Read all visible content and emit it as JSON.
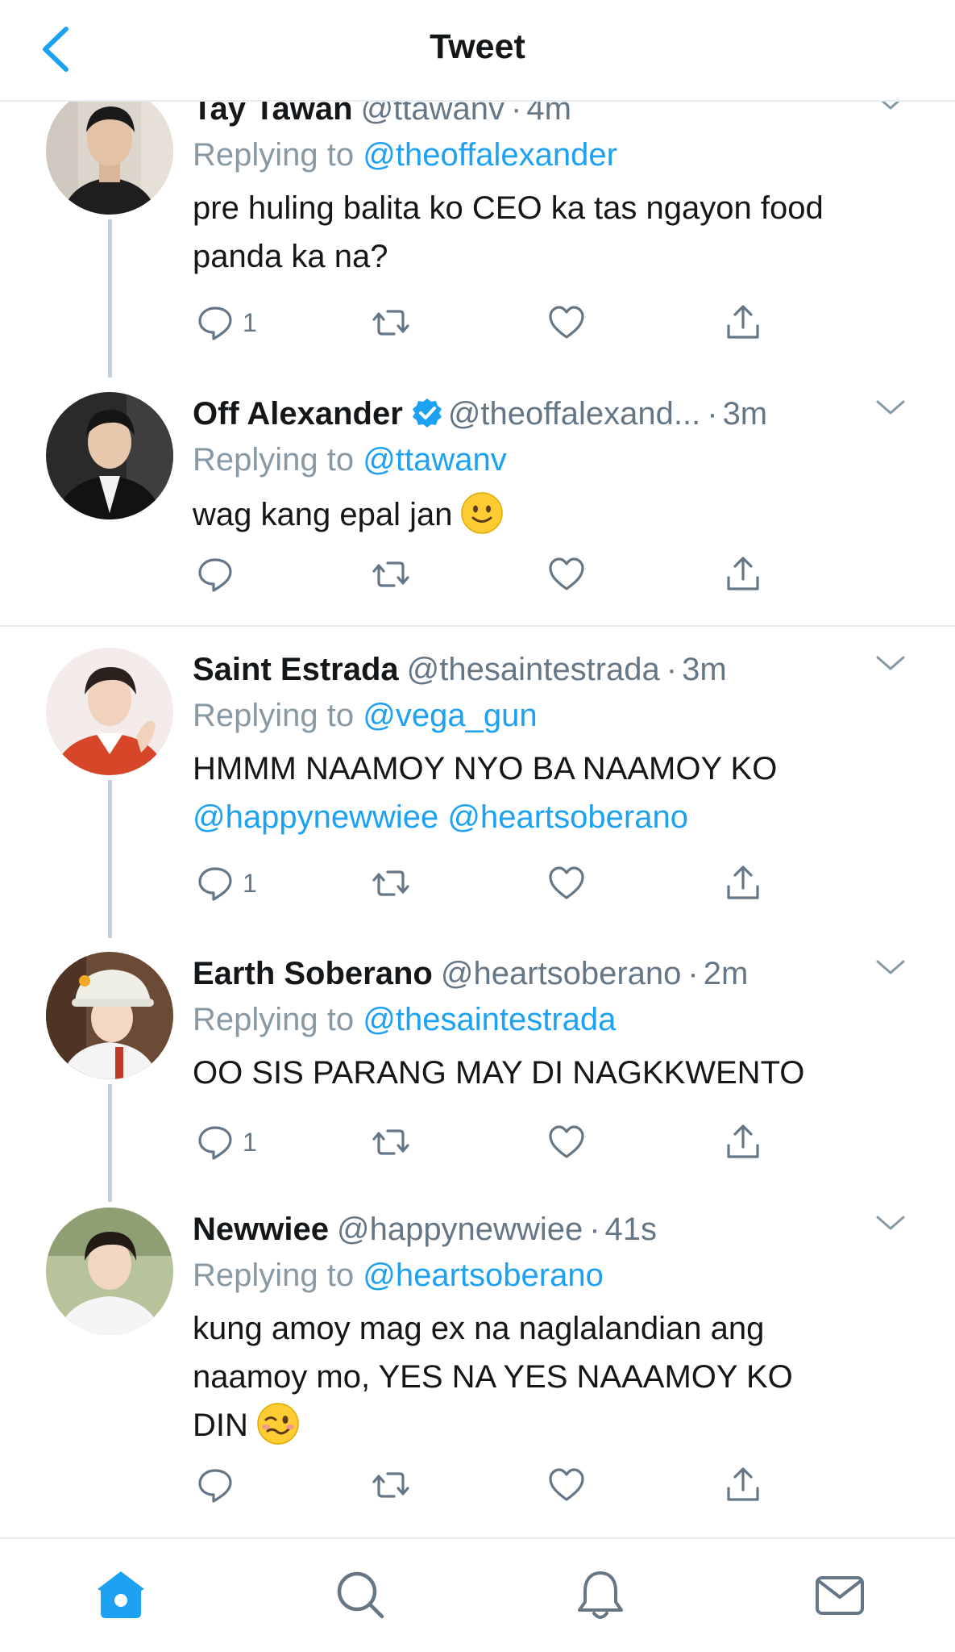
{
  "header": {
    "title": "Tweet"
  },
  "tweets": [
    {
      "name": "Tay Tawan",
      "handle": "@ttawanv",
      "time": "4m",
      "replying_prefix": "Replying to",
      "replying_to": "@theoffalexander",
      "text": "pre huling balita ko CEO ka tas ngayon food panda ka na?",
      "reply_count": "1",
      "verified": false
    },
    {
      "name": "Off Alexander",
      "handle": "@theoffalexand...",
      "time": "3m",
      "replying_prefix": "Replying to",
      "replying_to": "@ttawanv",
      "text": "wag kang epal jan",
      "emoji": "slightly-smiling-face",
      "reply_count": "",
      "verified": true
    },
    {
      "name": "Saint Estrada",
      "handle": "@thesaintestrada",
      "time": "3m",
      "replying_prefix": "Replying to",
      "replying_to": "@vega_gun",
      "text": "HMMM NAAMOY NYO BA NAAMOY KO",
      "mention1": "@happynewwiee",
      "mention2": "@heartsoberano",
      "reply_count": "1",
      "verified": false
    },
    {
      "name": "Earth Soberano",
      "handle": "@heartsoberano",
      "time": "2m",
      "replying_prefix": "Replying to",
      "replying_to": "@thesaintestrada",
      "text": "OO SIS PARANG MAY DI NAGKKWENTO",
      "reply_count": "1",
      "verified": false
    },
    {
      "name": "Newwiee",
      "handle": "@happynewwiee",
      "time": "41s",
      "replying_prefix": "Replying to",
      "replying_to": "@heartsoberano",
      "text_line1": "kung amoy mag ex na naglalandian ang",
      "text_line2": "naamoy mo, YES NA YES NAAAMOY KO",
      "text_line3": "DIN",
      "emoji": "woozy-face",
      "reply_count": "",
      "verified": false
    }
  ],
  "dot": "·",
  "tabs": [
    "home",
    "search",
    "notifications",
    "messages"
  ],
  "colors": {
    "accent": "#1da1f2",
    "muted": "#8899a6",
    "text": "#14171a",
    "divider": "#e6ecf0"
  }
}
